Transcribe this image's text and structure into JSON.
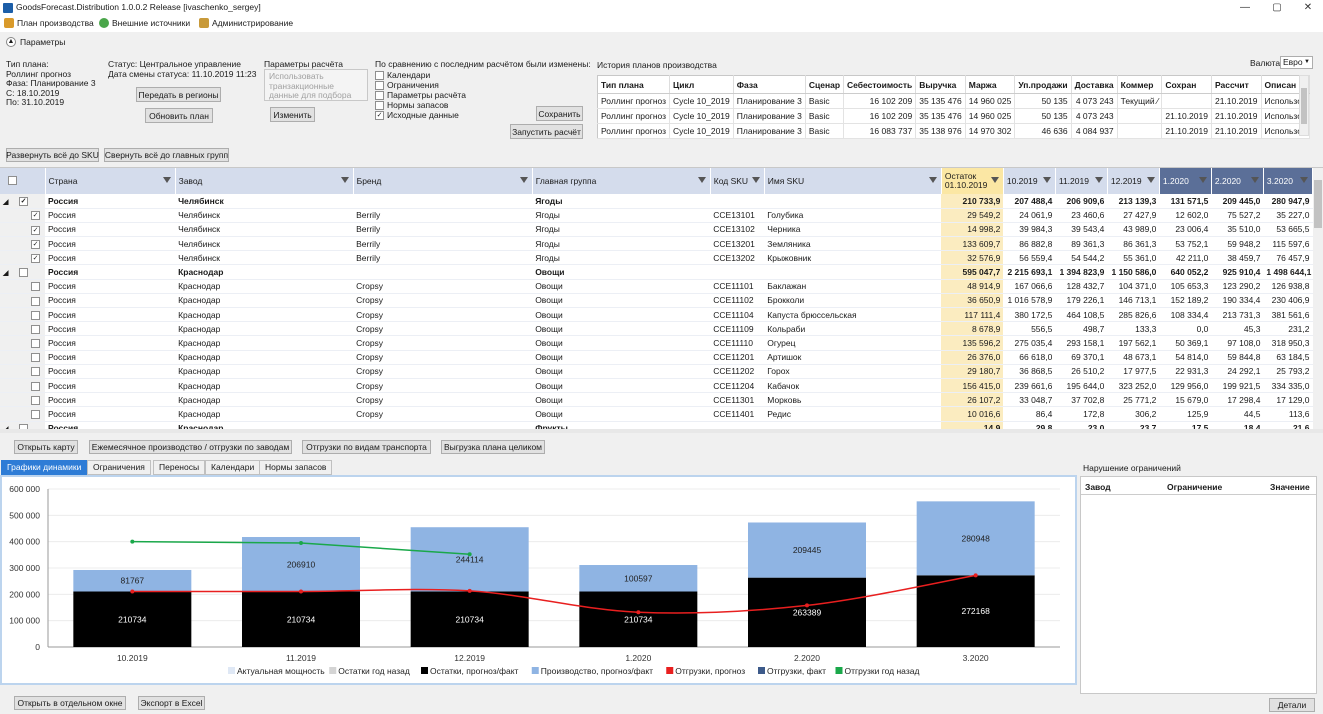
{
  "window": {
    "title": "GoodsForecast.Distribution 1.0.0.2 Release [ivaschenko_sergey]",
    "controls": [
      "—",
      "▢",
      "✕"
    ]
  },
  "menu": {
    "items": [
      {
        "label": "План производства",
        "color": "#d99a2b"
      },
      {
        "label": "Внешние источники",
        "color": "#4aa64a"
      },
      {
        "label": "Администрирование",
        "color": "#c89a3a"
      }
    ]
  },
  "params": {
    "toggle_label": "Параметры",
    "plan_info": {
      "type_label": "Тип плана:",
      "type_value": "Роллинг прогноз",
      "phase": "Фаза: Планирование 3",
      "from": "С: 18.10.2019",
      "to": "По: 31.10.2019"
    },
    "status": {
      "status_line": "Статус:  Центральное управление",
      "date_line": "Дата смены статуса: 11.10.2019 11:23",
      "send_button": "Передать в регионы",
      "refresh_button": "Обновить план"
    },
    "calc": {
      "title": "Параметры расчёта",
      "textbox": "Использовать\nтранзакционные\nданные для подбора",
      "change_button": "Изменить"
    },
    "changed": {
      "title": "По сравнению с последним расчётом были изменены:",
      "items": [
        {
          "label": "Календари",
          "checked": false
        },
        {
          "label": "Ограничения",
          "checked": false
        },
        {
          "label": "Параметры расчёта",
          "checked": false
        },
        {
          "label": "Нормы запасов",
          "checked": false
        },
        {
          "label": "Исходные данные",
          "checked": true
        }
      ],
      "save_button": "Сохранить",
      "run_button": "Запустить расчёт"
    }
  },
  "history": {
    "title": "История планов производства",
    "currency_label": "Валюта:",
    "currency_value": "Евро",
    "columns": [
      "Тип плана",
      "Цикл",
      "Фаза",
      "Сценар",
      "Себестоимость",
      "Выручка",
      "Маржа",
      "Уп.продажи",
      "Доставка",
      "Коммер",
      "Сохран",
      "Рассчит",
      "Описан"
    ],
    "rows": [
      [
        "Роллинг прогноз",
        "Cycle 10_2019",
        "Планирование 3",
        "Basic",
        "16 102 209",
        "35 135 476",
        "14 960 025",
        "50 135",
        "4 073 243",
        "Текущий ⁄",
        "",
        "21.10.2019",
        "Использов"
      ],
      [
        "Роллинг прогноз",
        "Cycle 10_2019",
        "Планирование 3",
        "Basic",
        "16 102 209",
        "35 135 476",
        "14 960 025",
        "50 135",
        "4 073 243",
        "",
        "21.10.2019",
        "21.10.2019",
        "Использов"
      ],
      [
        "Роллинг прогноз",
        "Cycle 10_2019",
        "Планирование 3",
        "Basic",
        "16 083 737",
        "35 138 976",
        "14 970 302",
        "46 636",
        "4 084 937",
        "",
        "21.10.2019",
        "21.10.2019",
        "Использов"
      ]
    ]
  },
  "grid_actions": {
    "expand": "Развернуть всё до SKU",
    "collapse": "Свернуть всё до главных групп"
  },
  "grid": {
    "columns": [
      "Страна",
      "Завод",
      "Бренд",
      "Главная группа",
      "Код SKU",
      "Имя SKU",
      "Остаток\n01.10.2019",
      "10.2019",
      "11.2019",
      "12.2019",
      "1.2020",
      "2.2020",
      "3.2020"
    ],
    "rows": [
      {
        "g": true,
        "exp": "◢",
        "chk": "✓",
        "c": [
          "Россия",
          "Челябинск",
          "",
          "Ягоды",
          "",
          "",
          "210 733,9",
          "207 488,4",
          "206 909,6",
          "213 139,3",
          "131 571,5",
          "209 445,0",
          "280 947,9"
        ]
      },
      {
        "g": false,
        "chk": "✓",
        "c": [
          "Россия",
          "Челябинск",
          "Berrily",
          "Ягоды",
          "CCE13101",
          "Голубика",
          "29 549,2",
          "24 061,9",
          "23 460,6",
          "27 427,9",
          "12 602,0",
          "75 527,2",
          "35 227,0"
        ]
      },
      {
        "g": false,
        "chk": "✓",
        "c": [
          "Россия",
          "Челябинск",
          "Berrily",
          "Ягоды",
          "CCE13102",
          "Черника",
          "14 998,2",
          "39 984,3",
          "39 543,4",
          "43 989,0",
          "23 006,4",
          "35 510,0",
          "53 665,5"
        ]
      },
      {
        "g": false,
        "chk": "✓",
        "c": [
          "Россия",
          "Челябинск",
          "Berrily",
          "Ягоды",
          "CCE13201",
          "Земляника",
          "133 609,7",
          "86 882,8",
          "89 361,3",
          "86 361,3",
          "53 752,1",
          "59 948,2",
          "115 597,6"
        ]
      },
      {
        "g": false,
        "chk": "✓",
        "c": [
          "Россия",
          "Челябинск",
          "Berrily",
          "Ягоды",
          "CCE13202",
          "Крыжовник",
          "32 576,9",
          "56 559,4",
          "54 544,2",
          "55 361,0",
          "42 211,0",
          "38 459,7",
          "76 457,9"
        ]
      },
      {
        "g": true,
        "exp": "◢",
        "chk": "",
        "c": [
          "Россия",
          "Краснодар",
          "",
          "Овощи",
          "",
          "",
          "595 047,7",
          "2 215 693,1",
          "1 394 823,9",
          "1 150 586,0",
          "640 052,2",
          "925 910,4",
          "1 498 644,1"
        ]
      },
      {
        "g": false,
        "chk": "",
        "c": [
          "Россия",
          "Краснодар",
          "Cropsy",
          "Овощи",
          "CCE11101",
          "Баклажан",
          "48 914,9",
          "167 066,6",
          "128 432,7",
          "104 371,0",
          "105 653,3",
          "123 290,2",
          "126 938,8"
        ]
      },
      {
        "g": false,
        "chk": "",
        "c": [
          "Россия",
          "Краснодар",
          "Cropsy",
          "Овощи",
          "CCE11102",
          "Брокколи",
          "36 650,9",
          "1 016 578,9",
          "179 226,1",
          "146 713,1",
          "152 189,2",
          "190 334,4",
          "230 406,9"
        ]
      },
      {
        "g": false,
        "chk": "",
        "c": [
          "Россия",
          "Краснодар",
          "Cropsy",
          "Овощи",
          "CCE11104",
          "Капуста брюссельская",
          "117 111,4",
          "380 172,5",
          "464 108,5",
          "285 826,6",
          "108 334,4",
          "213 731,3",
          "381 561,6"
        ]
      },
      {
        "g": false,
        "chk": "",
        "c": [
          "Россия",
          "Краснодар",
          "Cropsy",
          "Овощи",
          "CCE11109",
          "Кольраби",
          "8 678,9",
          "556,5",
          "498,7",
          "133,3",
          "0,0",
          "45,3",
          "231,2"
        ]
      },
      {
        "g": false,
        "chk": "",
        "c": [
          "Россия",
          "Краснодар",
          "Cropsy",
          "Овощи",
          "CCE11110",
          "Огурец",
          "135 596,2",
          "275 035,4",
          "293 158,1",
          "197 562,1",
          "50 369,1",
          "97 108,0",
          "318 950,3"
        ]
      },
      {
        "g": false,
        "chk": "",
        "c": [
          "Россия",
          "Краснодар",
          "Cropsy",
          "Овощи",
          "CCE11201",
          "Артишок",
          "26 376,0",
          "66 618,0",
          "69 370,1",
          "48 673,1",
          "54 814,0",
          "59 844,8",
          "63 184,5"
        ]
      },
      {
        "g": false,
        "chk": "",
        "c": [
          "Россия",
          "Краснодар",
          "Cropsy",
          "Овощи",
          "CCE11202",
          "Горох",
          "29 180,7",
          "36 868,5",
          "26 510,2",
          "17 977,5",
          "22 931,3",
          "24 292,1",
          "25 793,2"
        ]
      },
      {
        "g": false,
        "chk": "",
        "c": [
          "Россия",
          "Краснодар",
          "Cropsy",
          "Овощи",
          "CCE11204",
          "Кабачок",
          "156 415,0",
          "239 661,6",
          "195 644,0",
          "323 252,0",
          "129 956,0",
          "199 921,5",
          "334 335,0"
        ]
      },
      {
        "g": false,
        "chk": "",
        "c": [
          "Россия",
          "Краснодар",
          "Cropsy",
          "Овощи",
          "CCE11301",
          "Морковь",
          "26 107,2",
          "33 048,7",
          "37 702,8",
          "25 771,2",
          "15 679,0",
          "17 298,4",
          "17 129,0"
        ]
      },
      {
        "g": false,
        "chk": "",
        "c": [
          "Россия",
          "Краснодар",
          "Cropsy",
          "Овощи",
          "CCE11401",
          "Редис",
          "10 016,6",
          "86,4",
          "172,8",
          "306,2",
          "125,9",
          "44,5",
          "113,6"
        ]
      },
      {
        "g": true,
        "exp": "◢",
        "chk": "",
        "c": [
          "Россия",
          "Краснодар",
          "",
          "Фрукты",
          "",
          "",
          "14,9",
          "29,8",
          "23,0",
          "23,7",
          "17,5",
          "18,4",
          "21,6"
        ]
      }
    ]
  },
  "bottom_actions": [
    "Открыть карту",
    "Ежемесячное производство / отгрузки по заводам",
    "Отгрузки по видам транспорта",
    "Выгрузка плана целиком"
  ],
  "tabs": [
    "Графики динамики",
    "Ограничения",
    "Переносы",
    "Календари",
    "Нормы запасов"
  ],
  "violations": {
    "title": "Нарушение ограничений",
    "columns": [
      "Завод",
      "Ограничение",
      "Значение"
    ],
    "details_button": "Детали"
  },
  "footer_actions": [
    "Открыть в отдельном окне",
    "Экспорт в Excel"
  ],
  "chart_data": {
    "type": "bar",
    "categories": [
      "10.2019",
      "11.2019",
      "12.2019",
      "1.2020",
      "2.2020",
      "3.2020"
    ],
    "ylim": [
      0,
      600000
    ],
    "yticks": [
      0,
      100000,
      200000,
      300000,
      400000,
      500000,
      600000
    ],
    "ytick_labels": [
      "0",
      "100 000",
      "200 000",
      "300 000",
      "400 000",
      "500 000",
      "600 000"
    ],
    "colors": {
      "stock": "#000000",
      "production": "#8fb4e3",
      "ship_forecast": "#e81f1f",
      "ship_last_year": "#1aa84a"
    },
    "series": [
      {
        "name": "Остатки, прогноз/факт",
        "values": [
          210734,
          210734,
          210734,
          210734,
          263389,
          272168
        ]
      },
      {
        "name": "Производство, прогноз/факт",
        "values": [
          81767,
          206910,
          244114,
          100597,
          209445,
          280948
        ]
      },
      {
        "name": "Отгрузки, прогноз",
        "values": [
          210734,
          210734,
          213000,
          132000,
          158000,
          272168
        ]
      },
      {
        "name": "Отгрузки год назад",
        "values": [
          400000,
          395000,
          352000,
          null,
          null,
          null
        ]
      }
    ],
    "bar_labels_stock": [
      "210734",
      "210734",
      "210734",
      "210734",
      "263389",
      "272168"
    ],
    "bar_labels_prod": [
      "81767",
      "206910",
      "244114",
      "100597",
      "209445",
      "280948"
    ],
    "legend": [
      {
        "label": "Актуальная мощность",
        "color": "#dfe8f5"
      },
      {
        "label": "Остатки год назад",
        "color": "#d4d4d4"
      },
      {
        "label": "Остатки, прогноз/факт",
        "color": "#000000"
      },
      {
        "label": "Производство, прогноз/факт",
        "color": "#8fb4e3"
      },
      {
        "label": "Отгрузки, прогноз",
        "color": "#e81f1f"
      },
      {
        "label": "Отгрузки, факт",
        "color": "#3d5a8a"
      },
      {
        "label": "Отгрузки год назад",
        "color": "#1aa84a"
      }
    ]
  }
}
